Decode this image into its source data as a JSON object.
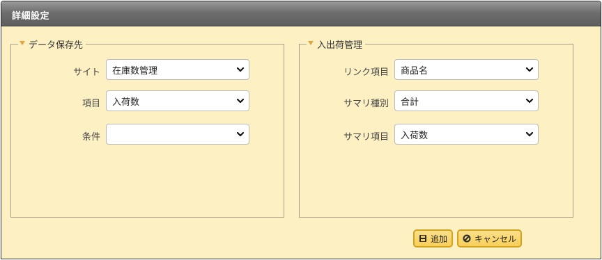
{
  "dialog": {
    "title": "詳細設定"
  },
  "data_store": {
    "legend": "データ保存先",
    "site_label": "サイト",
    "site_value": "在庫数管理",
    "item_label": "項目",
    "item_value": "入荷数",
    "condition_label": "条件",
    "condition_value": ""
  },
  "inbound": {
    "legend": "入出荷管理",
    "link_item_label": "リンク項目",
    "link_item_value": "商品名",
    "summary_type_label": "サマリ種別",
    "summary_type_value": "合計",
    "summary_item_label": "サマリ項目",
    "summary_item_value": "入荷数"
  },
  "buttons": {
    "add_label": "追加",
    "cancel_label": "キャンセル"
  },
  "colors": {
    "panel_bg": "#fdf1c4",
    "titlebar": "#6e6e6e",
    "button_bg": "#f7cf5a",
    "button_border": "#d4a11a",
    "legend_arrow": "#e8a33a"
  },
  "icons": {
    "dropdown": "chevron-down-icon",
    "add": "save-icon",
    "cancel": "prohibited-icon",
    "legend": "triangle-down-icon"
  }
}
